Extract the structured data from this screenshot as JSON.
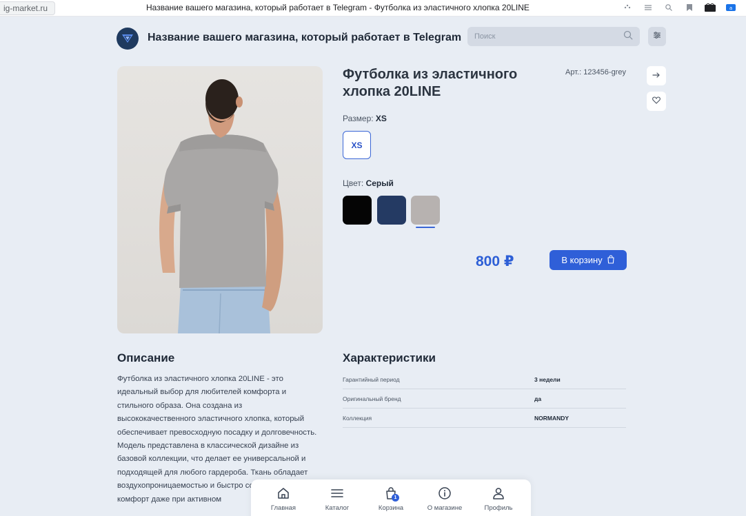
{
  "browser": {
    "url": "ig-market.ru",
    "title": "Название вашего магазина, который работает в Telegram - Футболка из эластичного хлопка 20LINE"
  },
  "header": {
    "store_name": "Название вашего магазина, который работает в Telegram",
    "search_placeholder": "Поиск"
  },
  "product": {
    "title": "Футболка из эластичного хлопка 20LINE",
    "sku": "Арт.: 123456-grey",
    "size_label": "Размер:",
    "size_selected": "XS",
    "sizes": [
      "XS"
    ],
    "color_label": "Цвет:",
    "color_selected": "Серый",
    "colors": [
      {
        "name": "black",
        "hex": "#050505"
      },
      {
        "name": "navy",
        "hex": "#243a63"
      },
      {
        "name": "grey",
        "hex": "#b7b2b0"
      }
    ],
    "price": "800 ₽",
    "cart_button": "В корзину"
  },
  "description": {
    "title": "Описание",
    "text": "Футболка из эластичного хлопка 20LINE - это идеальный выбор для любителей комфорта и стильного образа. Она создана из высококачественного эластичного хлопка, который обеспечивает превосходную посадку и долговечность. Модель представлена в классической дизайне из базовой коллекции, что делает ее универсальной и подходящей для любого гардероба. Ткань обладает воздухопроницаемостью и быстро сохнет, обеспечивая комфорт даже при активном"
  },
  "characteristics": {
    "title": "Характеристики",
    "rows": [
      {
        "name": "Гарантийный период",
        "value": "3 недели"
      },
      {
        "name": "Оригинальный бренд",
        "value": "да"
      },
      {
        "name": "Коллекция",
        "value": "NORMANDY"
      }
    ]
  },
  "bottom_nav": {
    "items": [
      {
        "label": "Главная",
        "icon": "home-icon"
      },
      {
        "label": "Каталог",
        "icon": "menu-icon"
      },
      {
        "label": "Корзина",
        "icon": "bag-icon",
        "badge": "1"
      },
      {
        "label": "О магазине",
        "icon": "info-icon"
      },
      {
        "label": "Профиль",
        "icon": "user-icon"
      }
    ]
  },
  "colors": {
    "accent": "#2f5fd8",
    "price": "#2d5fd6",
    "background": "#e8edf4"
  }
}
